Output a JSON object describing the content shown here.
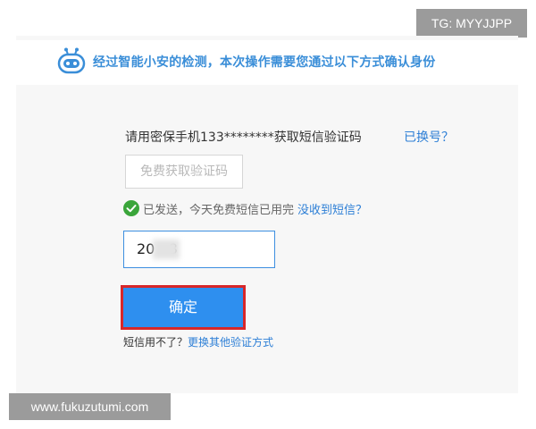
{
  "watermarks": {
    "top_right": "TG: MYYJJPP",
    "bottom_left": "www.fukuzutumi.com"
  },
  "banner": {
    "icon": "robot-icon",
    "text": "经过智能小安的检测，本次操作需要您通过以下方式确认身份"
  },
  "verification": {
    "prompt": "请用密保手机133********获取短信验证码",
    "change_number_link": "已换号？",
    "sms_button_label": "免费获取验证码",
    "status_icon": "check-circle-icon",
    "status_text": "已发送，今天免费短信已用完",
    "not_received_link": "没收到短信？",
    "code_value": "20   8",
    "confirm_label": "确定",
    "help_question": "短信用不了？",
    "help_link": "更换其他验证方式"
  },
  "colors": {
    "brand_blue": "#2e8fef",
    "link_blue": "#2d7fd6",
    "success_green": "#3aa53a",
    "highlight_red": "#d7272a"
  }
}
